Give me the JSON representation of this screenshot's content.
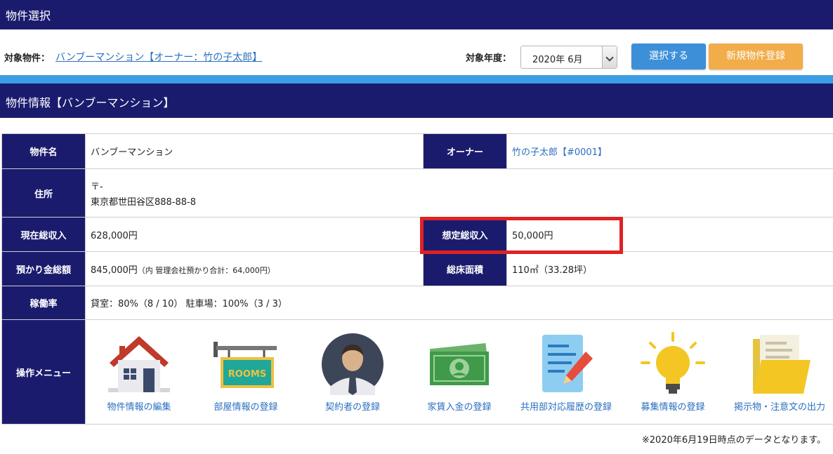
{
  "section1": {
    "title": "物件選択"
  },
  "selection": {
    "property_label": "対象物件：",
    "property_link": "バンブーマンション【オーナー：竹の子太郎】",
    "year_label": "対象年度：",
    "year_value": "2020年 6月",
    "select_button": "選択する",
    "new_button": "新規物件登録"
  },
  "section2": {
    "title": "物件情報【バンブーマンション】"
  },
  "info": {
    "name_label": "物件名",
    "name_value": "バンブーマンション",
    "owner_label": "オーナー",
    "owner_value": "竹の子太郎【#0001】",
    "address_label": "住所",
    "address_postal": "〒-",
    "address_value": "東京都世田谷区888-88-8",
    "income_label": "現在総収入",
    "income_value": "628,000円",
    "expected_label": "想定総収入",
    "expected_value": "50,000円",
    "deposit_label": "預かり金総額",
    "deposit_value": "845,000円",
    "deposit_note": "（内 管理会社預かり合計：64,000円）",
    "area_label": "総床面積",
    "area_value": "110㎡（33.28坪）",
    "occupancy_label": "稼働率",
    "occupancy_value": "貸室：80%（8 / 10） 駐車場：100%（3 / 3）",
    "menu_label": "操作メニュー"
  },
  "menu": [
    {
      "label": "物件情報の編集",
      "icon": "house-icon"
    },
    {
      "label": "部屋情報の登録",
      "icon": "rooms-sign-icon"
    },
    {
      "label": "契約者の登録",
      "icon": "person-icon"
    },
    {
      "label": "家賃入金の登録",
      "icon": "money-icon"
    },
    {
      "label": "共用部対応履歴の登録",
      "icon": "document-pen-icon"
    },
    {
      "label": "募集情報の登録",
      "icon": "lightbulb-icon"
    },
    {
      "label": "掲示物・注意文の出力",
      "icon": "folder-icon"
    }
  ],
  "sign_text": "ROOMS",
  "colors": {
    "header": "#1b1b6e",
    "stripe": "#3b9ee5",
    "link": "#2a6fc0",
    "highlight": "#e02222",
    "btn_blue": "#3d8fd8",
    "btn_orange": "#f1ad4a"
  },
  "footer_note": "※2020年6月19日時点のデータとなります。"
}
